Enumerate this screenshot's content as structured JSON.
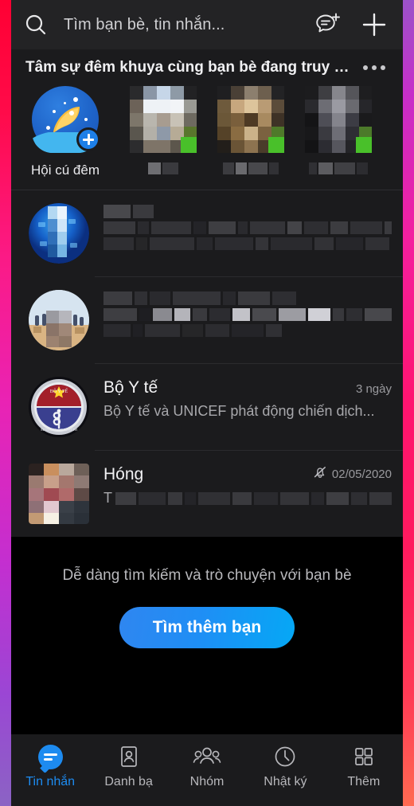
{
  "search": {
    "placeholder": "Tìm bạn bè, tin nhắn...",
    "icon": "search-icon"
  },
  "topbar": {
    "compose_icon": "new-message-icon",
    "add_icon": "plus-icon"
  },
  "stories": {
    "title": "Tâm sự đêm khuya cùng bạn bè đang truy c...",
    "more_icon": "more-options-icon",
    "items": [
      {
        "label": "Hội cú đêm",
        "type": "create",
        "badge": "plus-badge-icon"
      },
      {
        "label": "",
        "type": "thumb",
        "censored": true
      },
      {
        "label": "",
        "type": "thumb",
        "censored": true
      },
      {
        "label": "",
        "type": "thumb",
        "censored": true
      }
    ]
  },
  "conversations": [
    {
      "name": "",
      "preview": "",
      "time": "",
      "censored": true,
      "muted": false,
      "avatar": "blue-tech-globe"
    },
    {
      "name": "",
      "preview": "",
      "time": "",
      "censored": true,
      "muted": false,
      "avatar": "beach-photo"
    },
    {
      "name": "Bộ Y tế",
      "preview": "Bộ Y tế và UNICEF phát động chiến dịch...",
      "time": "3 ngày",
      "censored": false,
      "muted": false,
      "avatar": "ministry-of-health-emblem"
    },
    {
      "name": "Hóng",
      "preview": "T",
      "time": "02/05/2020",
      "censored": true,
      "muted": true,
      "mute_icon": "bell-muted-icon",
      "avatar": "censored-photo"
    }
  ],
  "empty_state": {
    "text": "Dễ dàng tìm kiếm và trò chuyện với bạn bè",
    "button_label": "Tìm thêm bạn"
  },
  "bottom_nav": {
    "active_index": 0,
    "items": [
      {
        "label": "Tin nhắn",
        "icon": "message-bubble-icon"
      },
      {
        "label": "Danh bạ",
        "icon": "contacts-card-icon"
      },
      {
        "label": "Nhóm",
        "icon": "group-people-icon"
      },
      {
        "label": "Nhật ký",
        "icon": "clock-timeline-icon"
      },
      {
        "label": "Thêm",
        "icon": "grid-more-icon"
      }
    ]
  },
  "colors": {
    "accent": "#1d8bf0",
    "panel": "#1b1b1d",
    "topbar": "#232325",
    "online_badge": "#49c02a",
    "bezel_left_top": "#ff0033",
    "bezel_right_bottom": "#ff6a52"
  }
}
